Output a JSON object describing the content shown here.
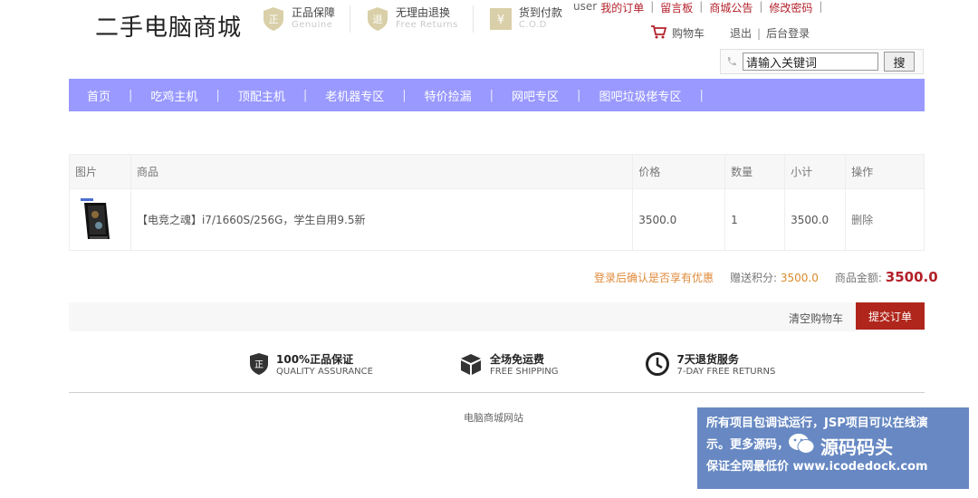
{
  "header": {
    "logo": "二手电脑商城",
    "badges": [
      {
        "icon": "shield-genuine-icon",
        "glyph": "正",
        "title": "正品保障",
        "subtitle": "Genuine"
      },
      {
        "icon": "shield-return-icon",
        "glyph": "退",
        "title": "无理由退换",
        "subtitle": "Free Returns"
      },
      {
        "icon": "cod-icon",
        "glyph": "¥",
        "title": "货到付款",
        "subtitle": "C.O.D"
      }
    ],
    "top_links": {
      "user": "user",
      "my_orders": "我的订单",
      "message_board": "留言板",
      "announcements": "商城公告",
      "change_password": "修改密码",
      "separator": "|"
    },
    "user_nav": {
      "cart": "购物车",
      "logout": "退出",
      "admin_login": "后台登录",
      "separator": "|"
    },
    "search": {
      "value": "请输入关键词",
      "button": "搜"
    }
  },
  "nav": {
    "items": [
      "首页",
      "吃鸡主机",
      "顶配主机",
      "老机器专区",
      "特价捡漏",
      "网吧专区",
      "图吧垃圾佬专区"
    ],
    "separator": "|"
  },
  "cart": {
    "columns": [
      "图片",
      "商品",
      "价格",
      "数量",
      "小计",
      "操作"
    ],
    "rows": [
      {
        "name": "【电竞之魂】i7/1660S/256G，学生自用9.5新",
        "price": "3500.0",
        "qty": "1",
        "subtotal": "3500.0",
        "action": "删除"
      }
    ],
    "promo": "登录后确认是否享有优惠",
    "points_label": "赠送积分:",
    "points": "3500.0",
    "total_label": "商品金额:",
    "total": "3500.0",
    "clear": "清空购物车",
    "submit": "提交订单"
  },
  "guarantees": [
    {
      "icon": "shield-quality-icon",
      "title": "100%正品保证",
      "subtitle": "QUALITY ASSURANCE"
    },
    {
      "icon": "box-shipping-icon",
      "title": "全场免运费",
      "subtitle": "FREE SHIPPING"
    },
    {
      "icon": "clock-returns-icon",
      "title": "7天退货服务",
      "subtitle": "7-DAY FREE RETURNS"
    }
  ],
  "footer": {
    "text": "电脑商城网站"
  },
  "watermark": {
    "line1": "所有项目包调试运行，JSP项目可以在线演",
    "line2": "示。更多源码，",
    "line3": "保证全网最低价 www.icodedock.com",
    "brand": "源码码头"
  },
  "colors": {
    "nav_bg": "#9999ff",
    "accent_red": "#b0261c",
    "link_red": "#b3202a",
    "promo_orange": "#e08a3a"
  }
}
